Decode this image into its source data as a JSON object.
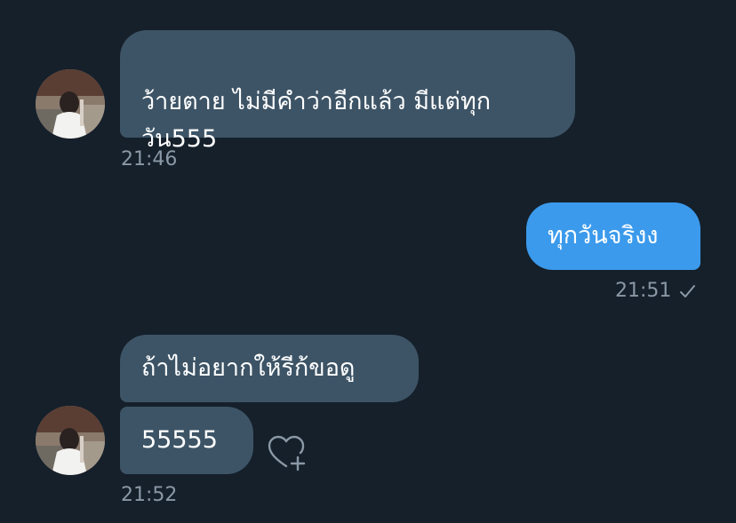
{
  "conversation": {
    "messages": [
      {
        "direction": "received",
        "text": "ว้ายตาย ไม่มีคำว่าอีกแล้ว มีแต่ทุก\nวัน555",
        "timestamp": "21:46"
      },
      {
        "direction": "sent",
        "text": "ทุกวันจริงง",
        "timestamp": "21:51"
      },
      {
        "direction": "received",
        "text": "ถ้าไม่อยากให้รีก้ขอดู"
      },
      {
        "direction": "received",
        "text": "55555",
        "timestamp": "21:52"
      }
    ],
    "read_receipt_icon": "check-icon",
    "react_icon": "heart-plus-icon"
  },
  "colors": {
    "background": "#15202b",
    "received_bubble": "#3d5466",
    "sent_bubble": "#3b9aec",
    "timestamp": "#8b98a5"
  }
}
